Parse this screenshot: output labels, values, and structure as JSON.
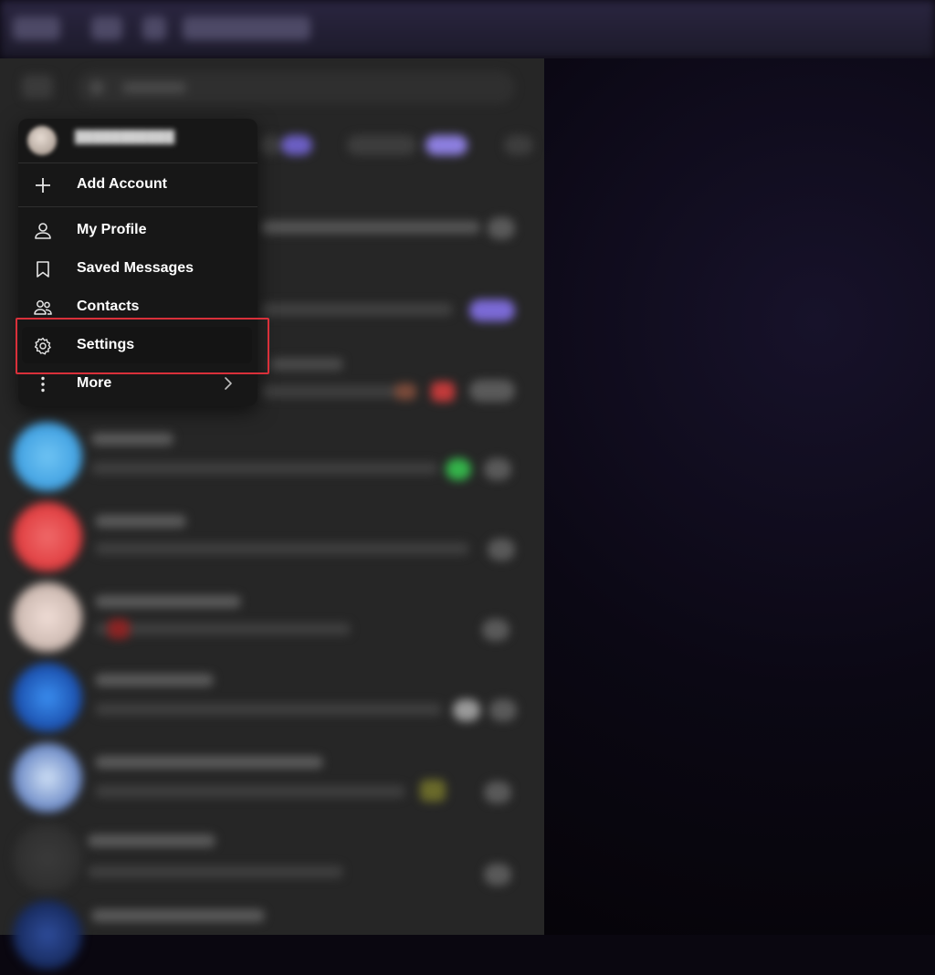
{
  "menu": {
    "items": [
      {
        "label": "Add Account",
        "icon": "plus-icon"
      },
      {
        "label": "My Profile",
        "icon": "user-icon"
      },
      {
        "label": "Saved Messages",
        "icon": "bookmark-icon"
      },
      {
        "label": "Contacts",
        "icon": "contacts-icon"
      },
      {
        "label": "Settings",
        "icon": "gear-icon"
      },
      {
        "label": "More",
        "icon": "more-vertical-icon"
      }
    ]
  },
  "colors": {
    "panel_bg": "#262626",
    "menu_bg": "#161616",
    "highlight_border": "#d9303a",
    "accent": "#7b6ad6"
  }
}
